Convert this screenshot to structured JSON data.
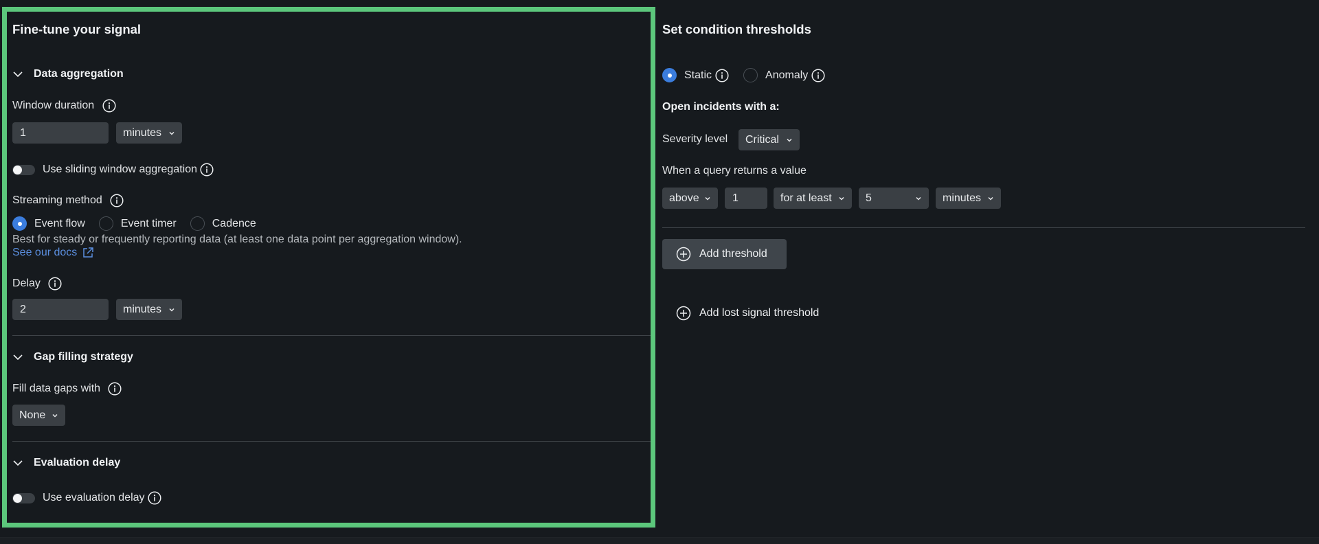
{
  "left": {
    "title": "Fine-tune your signal",
    "data_aggregation": {
      "heading": "Data aggregation",
      "window_duration_label": "Window duration",
      "window_duration_value": "1",
      "window_duration_unit": "minutes",
      "sliding_window_label": "Use sliding window aggregation",
      "sliding_window_enabled": false,
      "streaming_method_label": "Streaming method",
      "streaming_options": [
        {
          "label": "Event flow",
          "selected": true
        },
        {
          "label": "Event timer",
          "selected": false
        },
        {
          "label": "Cadence",
          "selected": false
        }
      ],
      "streaming_description": "Best for steady or frequently reporting data (at least one data point per aggregation window).",
      "docs_link": "See our docs",
      "delay_label": "Delay",
      "delay_value": "2",
      "delay_unit": "minutes"
    },
    "gap_filling": {
      "heading": "Gap filling strategy",
      "fill_label": "Fill data gaps with",
      "fill_value": "None"
    },
    "evaluation_delay": {
      "heading": "Evaluation delay",
      "toggle_label": "Use evaluation delay",
      "enabled": false
    }
  },
  "right": {
    "title": "Set condition thresholds",
    "threshold_types": [
      {
        "label": "Static",
        "selected": true
      },
      {
        "label": "Anomaly",
        "selected": false
      }
    ],
    "open_incidents_label": "Open incidents with a:",
    "severity_label": "Severity level",
    "severity_value": "Critical",
    "query_label": "When a query returns a value",
    "operator": "above",
    "threshold_value": "1",
    "duration_mode": "for at least",
    "duration_value": "5",
    "duration_unit": "minutes",
    "add_threshold": "Add threshold",
    "add_lost_signal": "Add lost signal threshold"
  },
  "colors": {
    "background": "#161a1e",
    "highlight_border": "#5cc77c",
    "accent": "#3b7ddd",
    "link": "#5b8fe0",
    "control_bg": "#3a3f44"
  }
}
